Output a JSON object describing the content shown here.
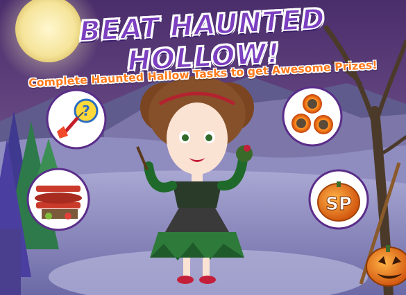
{
  "banner": {
    "title": "BEAT HAUNTED HOLLOW!",
    "subtitle": "Complete Haunted Hallow Tasks to get Awesome Prizes!"
  },
  "prizes": [
    {
      "name": "dart-mystery-icon"
    },
    {
      "name": "biplane-icon"
    },
    {
      "name": "flaming-fireballs-icon"
    },
    {
      "name": "sp-pumpkin-icon",
      "label": "SP"
    }
  ],
  "colors": {
    "title": "#7b3fbf",
    "subtitle": "#ff7a1a",
    "sky": "#3a3868",
    "moon": "#fff2b0",
    "bubble_ring": "#5a2d8a"
  }
}
